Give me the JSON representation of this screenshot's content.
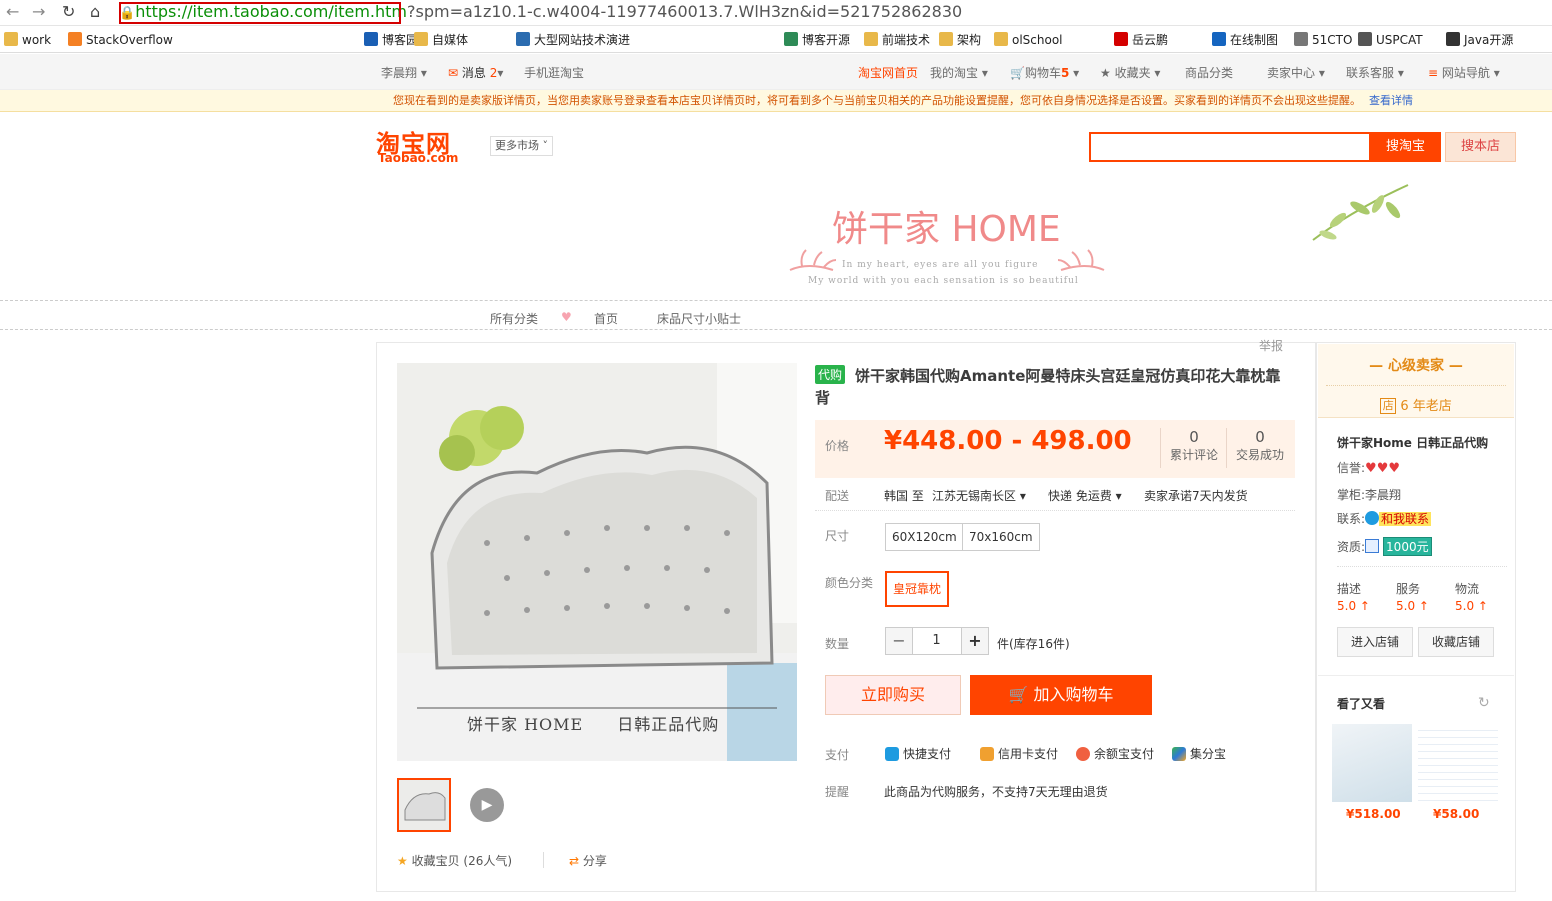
{
  "browser": {
    "url_secure": "https://item.taobao.com/item.htm",
    "url_rest": "?spm=a1z10.1-c.w4004-11977460013.7.WlH3zn&id=521752862830",
    "bookmarks": [
      "work",
      "StackOverflow",
      "博客园",
      "自媒体",
      "大型网站技术演进",
      "博客开源",
      "前端技术",
      "架构",
      "olSchool",
      "岳云鹏",
      "在线制图",
      "51CTO",
      "USPCAT",
      "Java开源"
    ]
  },
  "topbar": {
    "user": "李晨翔",
    "messages": "消息",
    "msg_count": "2",
    "mobile": "手机逛淘宝",
    "home": "淘宝网首页",
    "my_taobao": "我的淘宝",
    "cart": "购物车",
    "cart_count": "5",
    "favorites": "收藏夹",
    "categories": "商品分类",
    "seller_center": "卖家中心",
    "support": "联系客服",
    "site_nav": "网站导航"
  },
  "notice": {
    "text": "您现在看到的是卖家版详情页，当您用卖家账号登录查看本店宝贝详情页时，将可看到多个与当前宝贝相关的产品功能设置提醒，您可依自身情况选择是否设置。买家看到的详情页不会出现这些提醒。",
    "link": "查看详情"
  },
  "header": {
    "logo": "淘宝网",
    "logo_sub": "Taobao.com",
    "more_market": "更多市场",
    "search_btn": "搜淘宝",
    "store_btn": "搜本店"
  },
  "banner": {
    "title": "饼干家 HOME",
    "sub1": "In my heart, eyes are all you figure",
    "sub2": "My world with you each sensation is so beautiful"
  },
  "storenav": {
    "all": "所有分类",
    "home": "首页",
    "tips": "床品尺寸小贴士"
  },
  "product": {
    "report": "举报",
    "tag": "代购",
    "title": "饼干家韩国代购Amante阿曼特床头宫廷皇冠仿真印花大靠枕靠背",
    "price_label": "价格",
    "price": "¥448.00 - 498.00",
    "reviews_count": "0",
    "reviews_label": "累计评论",
    "sales_count": "0",
    "sales_label": "交易成功",
    "ship_label": "配送",
    "ship_from": "韩国 至",
    "ship_to": "江苏无锡南长区",
    "ship_method": "快递 免运费",
    "ship_promise": "卖家承诺7天内发货",
    "size_label": "尺寸",
    "sizes": [
      "60X120cm",
      "70x160cm"
    ],
    "color_label": "颜色分类",
    "color": "皇冠靠枕",
    "qty_label": "数量",
    "qty": "1",
    "stock": "件(库存16件)",
    "buy_now": "立即购买",
    "add_cart": "加入购物车",
    "pay_label": "支付",
    "pay": [
      "快捷支付",
      "信用卡支付",
      "余额宝支付",
      "集分宝"
    ],
    "remind_label": "提醒",
    "remind": "此商品为代购服务，不支持7天无理由退货",
    "fav": "收藏宝贝 (26人气)",
    "share": "分享",
    "img_caption": "饼干家 HOME　　日韩正品代购"
  },
  "seller": {
    "level": "心级卖家",
    "age": "6 年老店",
    "shop": "饼干家Home 日韩正品代购",
    "credit_label": "信誉:",
    "keeper_label": "掌柜:",
    "keeper": "李晨翔",
    "contact_label": "联系:",
    "contact": "和我联系",
    "qual_label": "资质:",
    "deposit": "1000元",
    "scores": [
      {
        "name": "描述",
        "val": "5.0"
      },
      {
        "name": "服务",
        "val": "5.0"
      },
      {
        "name": "物流",
        "val": "5.0"
      }
    ],
    "enter": "进入店铺",
    "collect": "收藏店铺",
    "seen_title": "看了又看",
    "seen_prices": [
      "¥518.00",
      "¥58.00"
    ]
  },
  "colors": {
    "brand": "#ff4400",
    "notice": "#d25200"
  }
}
